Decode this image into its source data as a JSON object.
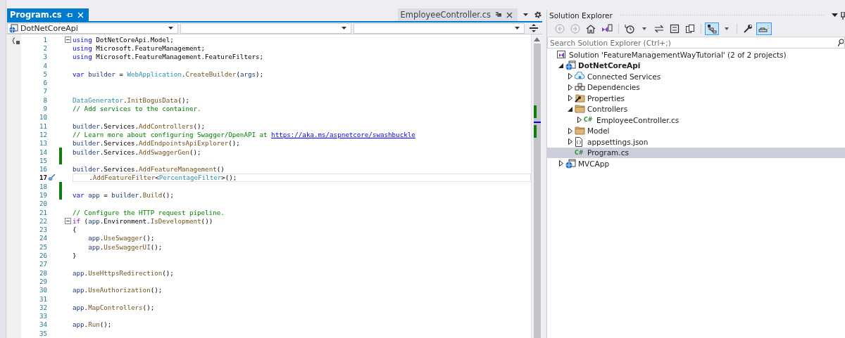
{
  "document_tabs": [
    {
      "title": "Program.cs",
      "selected": true,
      "pinned": false
    },
    {
      "title": "EmployeeController.cs",
      "selected": false,
      "pinned": true
    }
  ],
  "nav_bar": {
    "project": "DotNetCoreApi"
  },
  "code_lines": [
    {
      "number": "1",
      "fold": true,
      "segments": [
        {
          "kind": "keyword",
          "text": "using"
        },
        {
          "kind": "plain",
          "text": " DotNetCoreApi.Model;"
        }
      ]
    },
    {
      "number": "2",
      "segments": [
        {
          "kind": "keyword",
          "text": "using"
        },
        {
          "kind": "plain",
          "text": " Microsoft.FeatureManagement;"
        }
      ]
    },
    {
      "number": "3",
      "segments": [
        {
          "kind": "keyword",
          "text": "using"
        },
        {
          "kind": "plain",
          "text": " Microsoft.FeatureManagement.FeatureFilters;"
        }
      ]
    },
    {
      "number": "4"
    },
    {
      "number": "5",
      "segments": [
        {
          "kind": "keyword",
          "text": "var"
        },
        {
          "kind": "local",
          "text": " builder"
        },
        {
          "kind": "plain",
          "text": " = "
        },
        {
          "kind": "type",
          "text": "WebApplication"
        },
        {
          "kind": "plain",
          "text": "."
        },
        {
          "kind": "method",
          "text": "CreateBuilder"
        },
        {
          "kind": "plain",
          "text": "("
        },
        {
          "kind": "local",
          "text": "args"
        },
        {
          "kind": "plain",
          "text": ");"
        }
      ]
    },
    {
      "number": "6"
    },
    {
      "number": "7"
    },
    {
      "number": "8",
      "segments": [
        {
          "kind": "type",
          "text": "DataGenerator"
        },
        {
          "kind": "plain",
          "text": "."
        },
        {
          "kind": "method",
          "text": "InitBogusData"
        },
        {
          "kind": "plain",
          "text": "();"
        }
      ]
    },
    {
      "number": "9",
      "segments": [
        {
          "kind": "comment",
          "text": "// Add services to the container."
        }
      ]
    },
    {
      "number": "10"
    },
    {
      "number": "11",
      "segments": [
        {
          "kind": "local",
          "text": "builder"
        },
        {
          "kind": "plain",
          "text": ".Services."
        },
        {
          "kind": "method",
          "text": "AddControllers"
        },
        {
          "kind": "plain",
          "text": "();"
        }
      ]
    },
    {
      "number": "12",
      "segments": [
        {
          "kind": "comment",
          "text": "// Learn more about configuring Swagger/OpenAPI at "
        },
        {
          "kind": "link",
          "text": "https://aka.ms/aspnetcore/swashbuckle"
        }
      ]
    },
    {
      "number": "13",
      "segments": [
        {
          "kind": "local",
          "text": "builder"
        },
        {
          "kind": "plain",
          "text": ".Services."
        },
        {
          "kind": "method",
          "text": "AddEndpointsApiExplorer"
        },
        {
          "kind": "plain",
          "text": "();"
        }
      ]
    },
    {
      "number": "14",
      "changed": true,
      "segments": [
        {
          "kind": "local",
          "text": "builder"
        },
        {
          "kind": "plain",
          "text": ".Services."
        },
        {
          "kind": "method",
          "text": "AddSwaggerGen"
        },
        {
          "kind": "plain",
          "text": "();"
        }
      ]
    },
    {
      "number": "15",
      "changed": true
    },
    {
      "number": "16",
      "segments": [
        {
          "kind": "local",
          "text": "builder"
        },
        {
          "kind": "plain",
          "text": ".Services."
        },
        {
          "kind": "method",
          "text": "AddFeatureManagement"
        },
        {
          "kind": "plain",
          "text": "()"
        }
      ]
    },
    {
      "number": "17",
      "current": true,
      "segments": [
        {
          "kind": "plain",
          "text": "    ."
        },
        {
          "kind": "method",
          "text": "AddFeatureFilter"
        },
        {
          "kind": "plain",
          "text": "<"
        },
        {
          "kind": "type",
          "text": "PercentageFilter"
        },
        {
          "kind": "plain",
          "text": ">();"
        }
      ]
    },
    {
      "number": "18",
      "changed": true
    },
    {
      "number": "19",
      "changed": true,
      "segments": [
        {
          "kind": "keyword",
          "text": "var"
        },
        {
          "kind": "local",
          "text": " app"
        },
        {
          "kind": "plain",
          "text": " = "
        },
        {
          "kind": "local",
          "text": "builder"
        },
        {
          "kind": "plain",
          "text": "."
        },
        {
          "kind": "method",
          "text": "Build"
        },
        {
          "kind": "plain",
          "text": "();"
        }
      ]
    },
    {
      "number": "20"
    },
    {
      "number": "21",
      "segments": [
        {
          "kind": "comment",
          "text": "// Configure the HTTP request pipeline."
        }
      ]
    },
    {
      "number": "22",
      "fold": true,
      "segments": [
        {
          "kind": "control",
          "text": "if"
        },
        {
          "kind": "plain",
          "text": " ("
        },
        {
          "kind": "local",
          "text": "app"
        },
        {
          "kind": "plain",
          "text": ".Environment."
        },
        {
          "kind": "method",
          "text": "IsDevelopment"
        },
        {
          "kind": "plain",
          "text": "())"
        }
      ]
    },
    {
      "number": "23",
      "segments": [
        {
          "kind": "plain",
          "text": "{"
        }
      ]
    },
    {
      "number": "24",
      "segments": [
        {
          "kind": "local",
          "text": "    app"
        },
        {
          "kind": "plain",
          "text": "."
        },
        {
          "kind": "method",
          "text": "UseSwagger"
        },
        {
          "kind": "plain",
          "text": "();"
        }
      ]
    },
    {
      "number": "25",
      "segments": [
        {
          "kind": "local",
          "text": "    app"
        },
        {
          "kind": "plain",
          "text": "."
        },
        {
          "kind": "method",
          "text": "UseSwaggerUI"
        },
        {
          "kind": "plain",
          "text": "();"
        }
      ]
    },
    {
      "number": "26",
      "segments": [
        {
          "kind": "plain",
          "text": "}"
        }
      ]
    },
    {
      "number": "27"
    },
    {
      "number": "28",
      "segments": [
        {
          "kind": "local",
          "text": "app"
        },
        {
          "kind": "plain",
          "text": "."
        },
        {
          "kind": "method",
          "text": "UseHttpsRedirection"
        },
        {
          "kind": "plain",
          "text": "();"
        }
      ]
    },
    {
      "number": "29"
    },
    {
      "number": "30",
      "segments": [
        {
          "kind": "local",
          "text": "app"
        },
        {
          "kind": "plain",
          "text": "."
        },
        {
          "kind": "method",
          "text": "UseAuthorization"
        },
        {
          "kind": "plain",
          "text": "();"
        }
      ]
    },
    {
      "number": "31"
    },
    {
      "number": "32",
      "segments": [
        {
          "kind": "local",
          "text": "app"
        },
        {
          "kind": "plain",
          "text": "."
        },
        {
          "kind": "method",
          "text": "MapControllers"
        },
        {
          "kind": "plain",
          "text": "();"
        }
      ]
    },
    {
      "number": "33"
    },
    {
      "number": "34",
      "segments": [
        {
          "kind": "local",
          "text": "app"
        },
        {
          "kind": "plain",
          "text": "."
        },
        {
          "kind": "method",
          "text": "Run"
        },
        {
          "kind": "plain",
          "text": "();"
        }
      ]
    },
    {
      "number": "35"
    }
  ],
  "solution_explorer": {
    "title": "Solution Explorer",
    "toolbar": [
      {
        "kind": "back",
        "on": false
      },
      {
        "kind": "forward",
        "on": false
      },
      {
        "kind": "home",
        "on": false
      },
      {
        "kind": "switch-views",
        "on": false
      },
      {
        "kind": "separator"
      },
      {
        "kind": "history",
        "on": false
      },
      {
        "kind": "dropdown",
        "on": false
      },
      {
        "kind": "sync",
        "on": false
      },
      {
        "kind": "collapse",
        "on": false
      },
      {
        "kind": "copy",
        "on": false
      },
      {
        "kind": "separator"
      },
      {
        "kind": "tree-view",
        "on": true
      },
      {
        "kind": "dropdown",
        "on": false
      },
      {
        "kind": "separator"
      },
      {
        "kind": "properties",
        "on": false
      },
      {
        "kind": "preview",
        "on": true
      }
    ],
    "search": {
      "placeholder": "Search Solution Explorer (Ctrl+;)"
    },
    "tree": [
      {
        "label": "Solution 'FeatureManagementWayTutorial' (2 of 2 projects)",
        "kind": "solution",
        "selected": false,
        "children": [
          {
            "label": "DotNetCoreApi",
            "kind": "project",
            "bold": true,
            "expanded": true,
            "selected": false,
            "children": [
              {
                "label": "Connected Services",
                "kind": "cloud",
                "expanded": false,
                "selected": false
              },
              {
                "label": "Dependencies",
                "kind": "dependencies",
                "expanded": false,
                "selected": false
              },
              {
                "label": "Properties",
                "kind": "properties",
                "expanded": false,
                "selected": false
              },
              {
                "label": "Controllers",
                "kind": "folder",
                "expanded": true,
                "selected": false,
                "children": [
                  {
                    "label": "EmployeeController.cs",
                    "kind": "csharp",
                    "badge": "C#",
                    "expanded": false,
                    "selected": false
                  }
                ]
              },
              {
                "label": "Model",
                "kind": "folder",
                "expanded": false,
                "selected": false
              },
              {
                "label": "appsettings.json",
                "kind": "json",
                "expanded": false,
                "selected": false
              },
              {
                "label": "Program.cs",
                "kind": "csharp",
                "badge": "C#",
                "selected": true
              }
            ]
          },
          {
            "label": "MVCApp",
            "kind": "project",
            "bold": false,
            "expanded": false,
            "selected": false
          }
        ]
      }
    ]
  }
}
